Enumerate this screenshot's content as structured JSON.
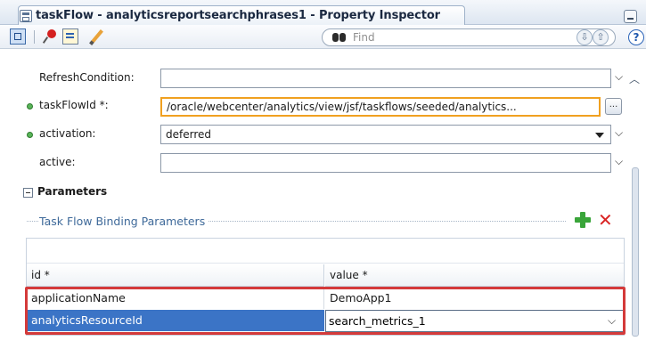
{
  "window": {
    "title": "taskFlow - analyticsreportsearchphrases1 - Property Inspector"
  },
  "toolbar": {
    "find_placeholder": "Find"
  },
  "properties": {
    "refresh_condition": {
      "label": "RefreshCondition:",
      "value": ""
    },
    "taskflow_id": {
      "label": "taskFlowId *:",
      "value": "/oracle/webcenter/analytics/view/jsf/taskflows/seeded/analytics...",
      "browse_label": "..."
    },
    "activation": {
      "label": "activation:",
      "value": "deferred"
    },
    "active": {
      "label": "active:",
      "value": ""
    }
  },
  "parameters": {
    "heading": "Parameters",
    "group_title": "Task Flow Binding Parameters",
    "columns": {
      "id": "id *",
      "value": "value *"
    },
    "rows": [
      {
        "id": "applicationName",
        "value": "DemoApp1"
      },
      {
        "id": "analyticsResourceId",
        "value": "search_metrics_1"
      }
    ]
  },
  "colors": {
    "required_field_border": "#f0a020",
    "selected_row": "#3b74c6",
    "highlight_box": "#d43a3a"
  }
}
